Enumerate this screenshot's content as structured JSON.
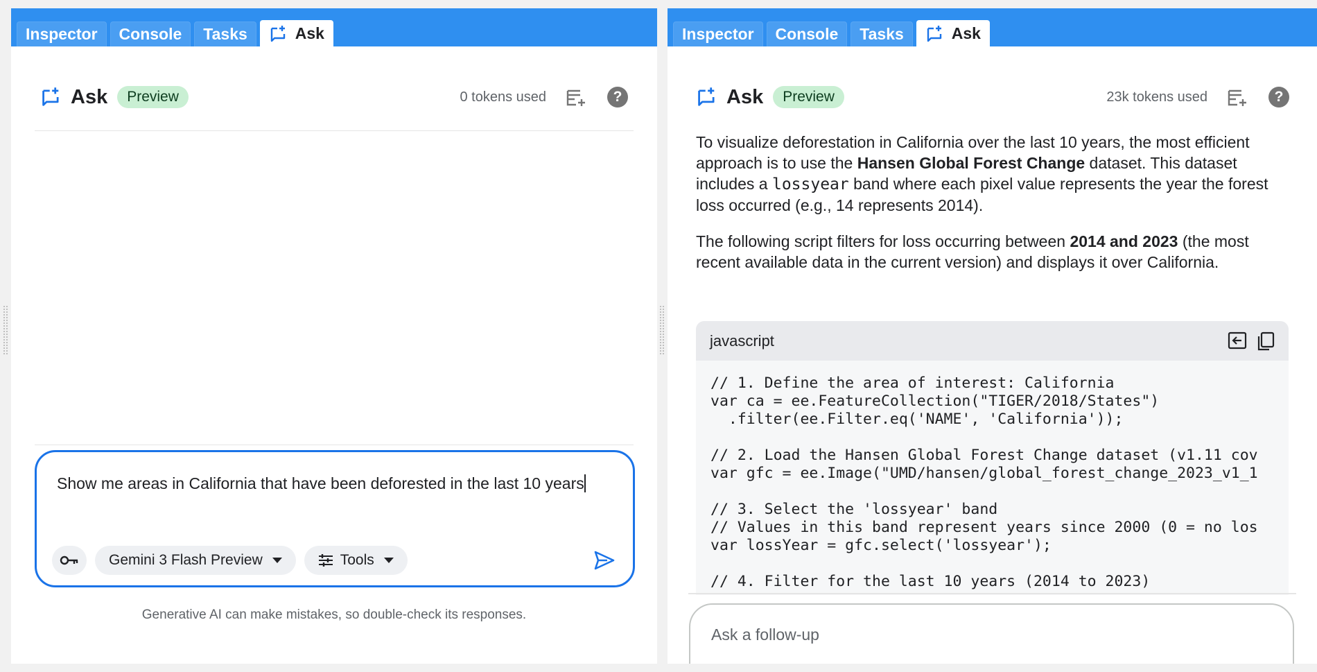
{
  "tabs": [
    {
      "label": "Inspector"
    },
    {
      "label": "Console"
    },
    {
      "label": "Tasks"
    },
    {
      "label": "Ask"
    }
  ],
  "left": {
    "header": {
      "title": "Ask",
      "badge": "Preview",
      "tokens": "0 tokens used"
    },
    "input": {
      "text": "Show me areas in California that have been deforested in the last 10 years"
    },
    "toolbar": {
      "model_label": "Gemini 3 Flash Preview",
      "tools_label": "Tools"
    },
    "disclaimer": "Generative AI can make mistakes, so double-check its responses."
  },
  "right": {
    "header": {
      "title": "Ask",
      "badge": "Preview",
      "tokens": "23k tokens used"
    },
    "response": {
      "p1_a": "To visualize deforestation in California over the last 10 years, the most efficient approach is to use the ",
      "p1_b": "Hansen Global Forest Change",
      "p1_c": " dataset. This dataset includes a ",
      "p1_code": "lossyear",
      "p1_d": " band where each pixel value represents the year the forest loss occurred (e.g., 14 represents 2014).",
      "p2_a": "The following script filters for loss occurring between ",
      "p2_b": "2014 and 2023",
      "p2_c": " (the most recent available data in the current version) and displays it over California."
    },
    "code_block": {
      "language": "javascript",
      "code": "// 1. Define the area of interest: California\nvar ca = ee.FeatureCollection(\"TIGER/2018/States\")\n  .filter(ee.Filter.eq('NAME', 'California'));\n\n// 2. Load the Hansen Global Forest Change dataset (v1.11 cov\nvar gfc = ee.Image(\"UMD/hansen/global_forest_change_2023_v1_1\n\n// 3. Select the 'lossyear' band\n// Values in this band represent years since 2000 (0 = no los\nvar lossYear = gfc.select('lossyear');\n\n// 4. Filter for the last 10 years (2014 to 2023)"
    },
    "follow_up": {
      "placeholder": "Ask a follow-up"
    }
  },
  "colors": {
    "tabbar": "#2f8ff0",
    "accent": "#1a73e8",
    "badge_bg": "#c9efd3"
  },
  "icons": [
    "ask-icon",
    "new-chat-icon",
    "help-icon",
    "key-icon",
    "tools-icon",
    "send-icon",
    "insert-code-icon",
    "copy-icon"
  ]
}
